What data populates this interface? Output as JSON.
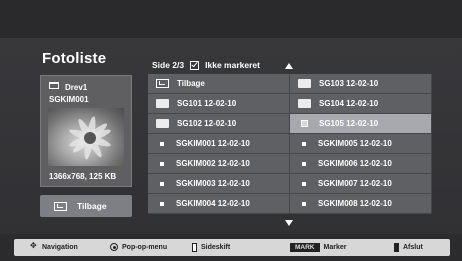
{
  "header": {
    "title": "Fotoliste",
    "page_info": "Side 2/3",
    "filter_label": "Ikke markeret"
  },
  "preview": {
    "drive_name": "Drev1",
    "file_name": "SGKIM001",
    "resolution": "1366x768, 125 KB"
  },
  "back_button": {
    "label": "Tilbage"
  },
  "files": {
    "left": [
      {
        "label": "Tilbage",
        "icon": "back-icon"
      },
      {
        "label": "SG101 12-02-10",
        "icon": "folder-icon"
      },
      {
        "label": "SG102 12-02-10",
        "icon": "folder-icon"
      },
      {
        "label": "SGKIM001 12-02-10",
        "icon": "file-icon"
      },
      {
        "label": "SGKIM002 12-02-10",
        "icon": "file-icon"
      },
      {
        "label": "SGKIM003 12-02-10",
        "icon": "file-icon"
      },
      {
        "label": "SGKIM004 12-02-10",
        "icon": "file-icon"
      }
    ],
    "right": [
      {
        "label": "SG103 12-02-10",
        "icon": "folder-icon"
      },
      {
        "label": "SG104 12-02-10",
        "icon": "folder-icon"
      },
      {
        "label": "SG105 12-02-10",
        "icon": "file-icon",
        "selected": true
      },
      {
        "label": "SGKIM005 12-02-10",
        "icon": "file-icon"
      },
      {
        "label": "SGKIM006 12-02-10",
        "icon": "file-icon"
      },
      {
        "label": "SGKIM007 12-02-10",
        "icon": "file-icon"
      },
      {
        "label": "SGKIM008 12-02-10",
        "icon": "file-icon"
      }
    ]
  },
  "footer": {
    "navigation": "Navigation",
    "popup_menu": "Pop-op-menu",
    "page_change": "Sideskift",
    "mark_key": "MARK",
    "mark": "Marker",
    "exit": "Afslut"
  }
}
